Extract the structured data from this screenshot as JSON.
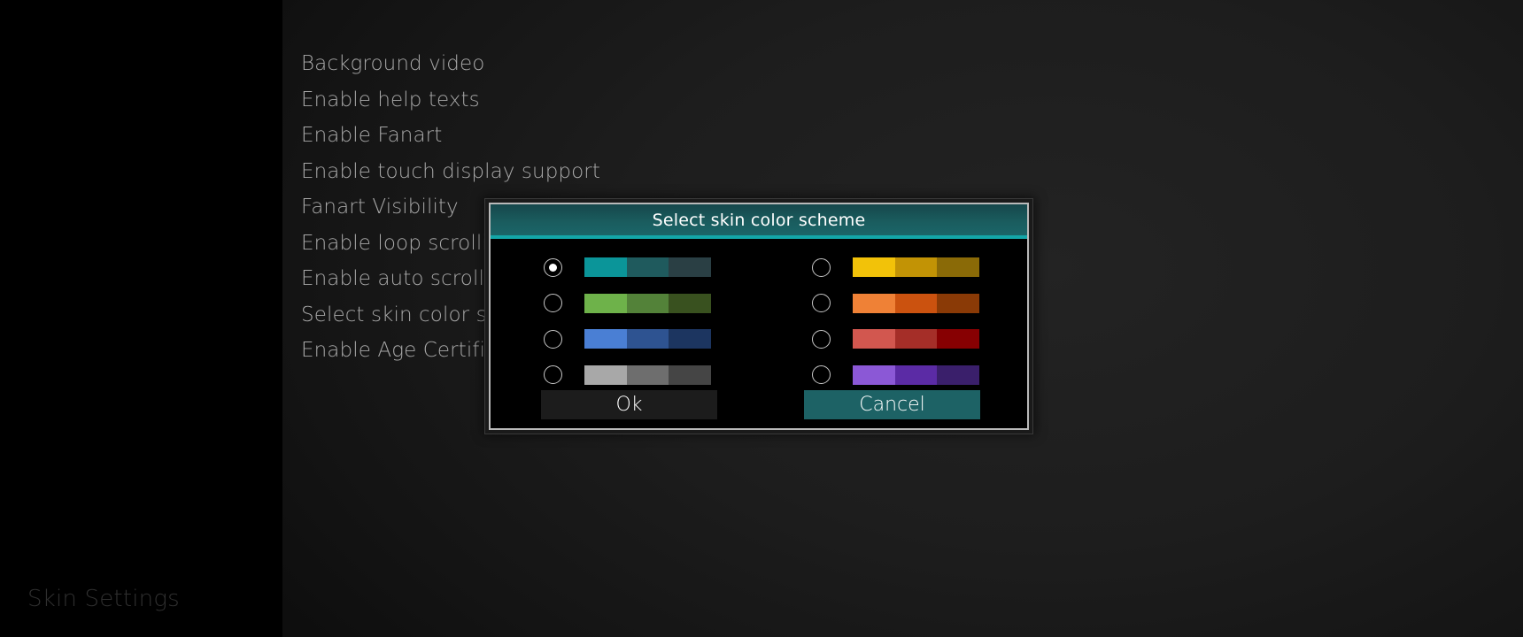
{
  "screen": {
    "footer_title": "Skin Settings",
    "settings": [
      {
        "label": "Background video"
      },
      {
        "label": "Enable help texts"
      },
      {
        "label": "Enable Fanart"
      },
      {
        "label": "Enable touch display support"
      },
      {
        "label": "Fanart Visibility"
      },
      {
        "label": "Enable loop scrolling"
      },
      {
        "label": "Enable auto scrolling"
      },
      {
        "label": "Select skin color scheme"
      },
      {
        "label": "Enable Age Certification"
      }
    ]
  },
  "dialog": {
    "title": "Select skin color scheme",
    "header_accent": "#13a6a8",
    "options": [
      {
        "name": "teal",
        "selected": true,
        "colors": [
          "#0b9599",
          "#1f5a5d",
          "#2a3f44"
        ]
      },
      {
        "name": "yellow",
        "selected": false,
        "colors": [
          "#f2c209",
          "#c29305",
          "#8a6a07"
        ]
      },
      {
        "name": "green",
        "selected": false,
        "colors": [
          "#6eb24a",
          "#538239",
          "#39511f"
        ]
      },
      {
        "name": "orange",
        "selected": false,
        "colors": [
          "#ef8136",
          "#cb520f",
          "#8a3a06"
        ]
      },
      {
        "name": "blue",
        "selected": false,
        "colors": [
          "#4a7fd4",
          "#2e5391",
          "#1c3560"
        ]
      },
      {
        "name": "red",
        "selected": false,
        "colors": [
          "#d2574f",
          "#a52e28",
          "#870002"
        ]
      },
      {
        "name": "grey",
        "selected": false,
        "colors": [
          "#a8a8a8",
          "#6e6e6e",
          "#454545"
        ]
      },
      {
        "name": "purple",
        "selected": false,
        "colors": [
          "#8b58d6",
          "#5b2ba5",
          "#3a1f6b"
        ]
      }
    ],
    "buttons": {
      "ok": "Ok",
      "cancel": "Cancel"
    }
  }
}
